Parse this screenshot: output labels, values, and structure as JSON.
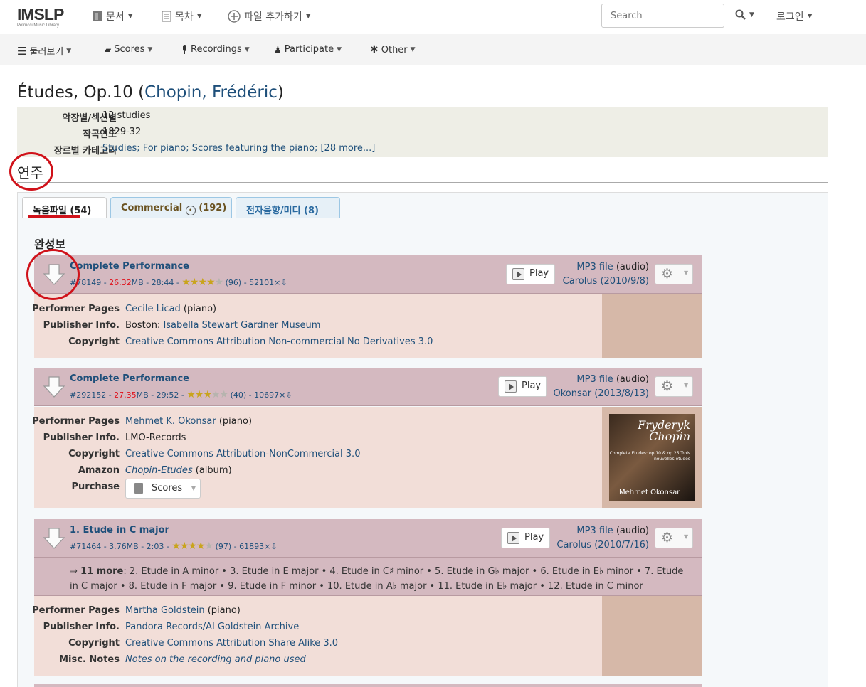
{
  "topnav": {
    "logo_main": "IMSLP",
    "logo_sub": "Petrucci Music Library",
    "doc": "문서",
    "toc": "목차",
    "add_file": "파일 추가하기",
    "search_placeholder": "Search",
    "login": "로그인"
  },
  "nav2": {
    "browse": "둘러보기",
    "scores": "Scores",
    "recordings": "Recordings",
    "participate": "Participate",
    "other": "Other"
  },
  "page": {
    "title_work": "Études, Op.10 (",
    "title_composer": "Chopin, Frédéric",
    "title_close": ")"
  },
  "info": [
    {
      "label": "악장별/섹션별",
      "value": "12 studies"
    },
    {
      "label": "작곡연도",
      "value": "1829-32"
    },
    {
      "label": "장르별 카테고리",
      "value": "Studies; For piano; Scores featuring the piano; [28 more...]"
    }
  ],
  "section_title": "연주",
  "tabs": [
    {
      "label": "녹음파일 (54)"
    },
    {
      "label_a": "Commercial",
      "label_b": "(192)"
    },
    {
      "label": "전자음향/미디 (8)"
    }
  ],
  "subhead": "완성보",
  "recordings": [
    {
      "title": "Complete Performance",
      "id": "#78149 - ",
      "size": "26.32",
      "size_unit": "MB - 28:44 - ",
      "rating_text": "(96) - 52101×⇩",
      "rating": 3.5,
      "play": "Play",
      "format_link": "MP3 file",
      "format_note": " (audio)",
      "uploader": "Carolus (2010/9/8)",
      "details": [
        {
          "label": "Performer Pages",
          "link": "Cecile Licad",
          "note": " (piano)"
        },
        {
          "label": "Publisher Info.",
          "text": "Boston: ",
          "link": "Isabella Stewart Gardner Museum"
        },
        {
          "label": "Copyright",
          "link": "Creative Commons Attribution Non-commercial No Derivatives 3.0"
        }
      ]
    },
    {
      "title": "Complete Performance",
      "id": "#292152 - ",
      "size": "27.35",
      "size_unit": "MB - 29:52 - ",
      "rating_text": "(40) - 10697×⇩",
      "rating": 3,
      "play": "Play",
      "format_link": "MP3 file",
      "format_note": " (audio)",
      "uploader": "Okonsar (2013/8/13)",
      "details": [
        {
          "label": "Performer Pages",
          "link": "Mehmet K. Okonsar",
          "note": " (piano)"
        },
        {
          "label": "Publisher Info.",
          "text": "LMO-Records"
        },
        {
          "label": "Copyright",
          "link": "Creative Commons Attribution-NonCommercial 3.0"
        },
        {
          "label": "Amazon",
          "link": "Chopin-Etudes",
          "note": " (album)"
        },
        {
          "label": "Purchase",
          "button": "Scores"
        }
      ],
      "album": {
        "line1": "Fryderyk",
        "line2": "Chopin",
        "sub": "Complete Etudes: op.10 & op.25 Trois nouvelles études",
        "artist": "Mehmet Okonsar"
      }
    },
    {
      "title": "1. Etude in C major",
      "id": "#71464 - ",
      "size_full": "3.76MB - 2:03 - ",
      "rating_text": "(97) - 61893×⇩",
      "rating": 3.5,
      "play": "Play",
      "format_link": "MP3 file",
      "format_note": " (audio)",
      "uploader": "Carolus (2010/7/16)",
      "more_prefix": "⇒ ",
      "more_link": "11 more",
      "more_text": ": 2. Etude in A minor • 3. Etude in E major • 4. Etude in C♯ minor • 5. Etude in G♭ major • 6. Etude in E♭ minor • 7. Etude in C major • 8. Etude in F major • 9. Etude in F minor • 10. Etude in A♭ major • 11. Etude in E♭ major • 12. Etude in C minor",
      "details": [
        {
          "label": "Performer Pages",
          "link": "Martha Goldstein",
          "note": " (piano)"
        },
        {
          "label": "Publisher Info.",
          "link": "Pandora Records/Al Goldstein Archive"
        },
        {
          "label": "Copyright",
          "link": "Creative Commons Attribution Share Alike 3.0"
        },
        {
          "label": "Misc. Notes",
          "link": "Notes on the recording and piano used"
        }
      ]
    }
  ],
  "colors": {
    "link": "#1e4f7a",
    "card_header": "#d4b9c0",
    "card_body": "#f2ded8",
    "annotation": "#d0121a"
  }
}
